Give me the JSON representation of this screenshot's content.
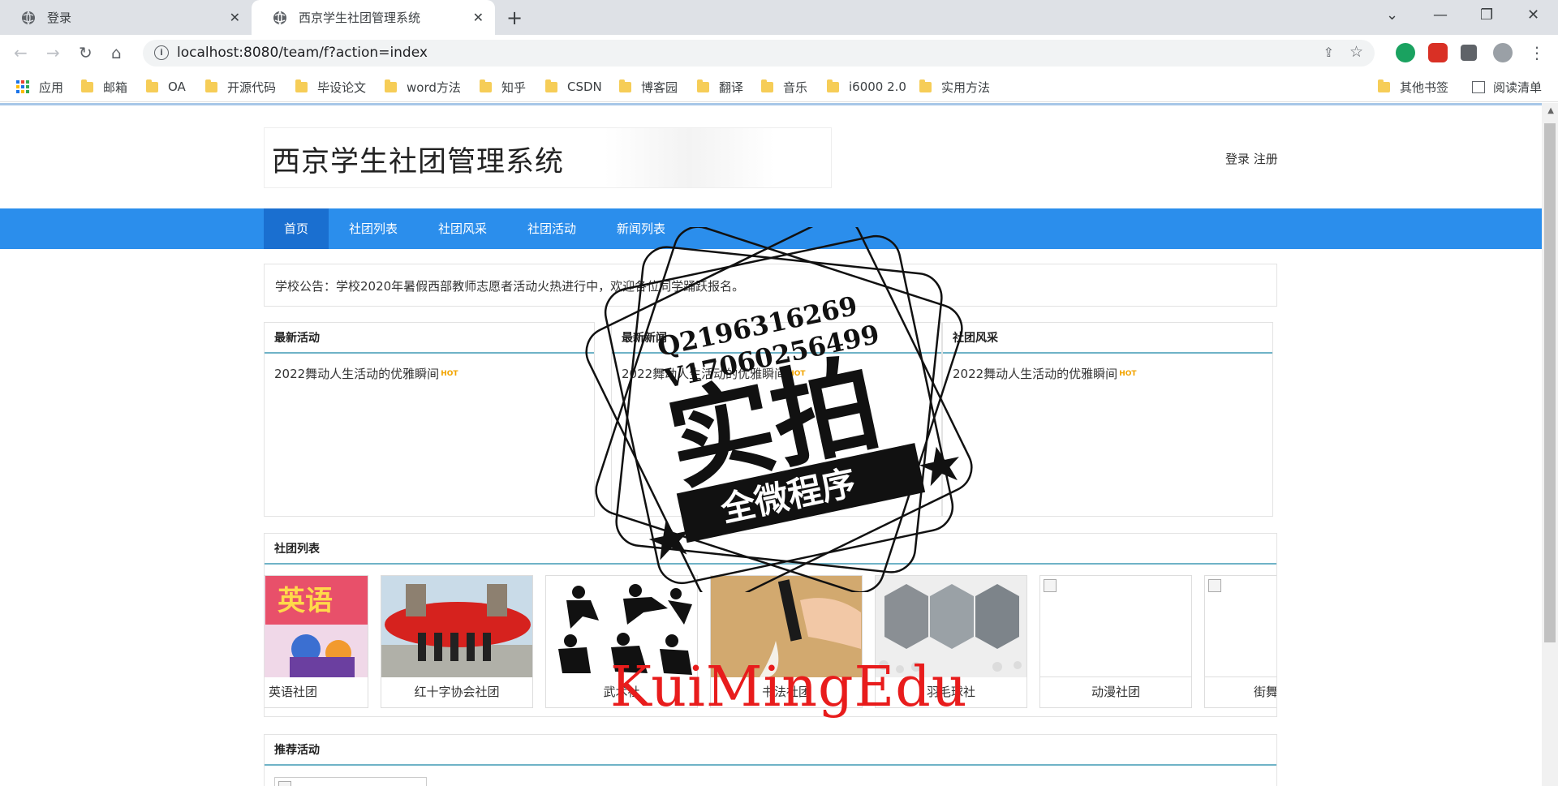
{
  "browser": {
    "tabs": [
      {
        "title": "登录"
      },
      {
        "title": "西京学生社团管理系统"
      }
    ],
    "new_tab": "+",
    "url": "localhost:8080/team/f?action=index",
    "bookmarks": [
      "应用",
      "邮箱",
      "OA",
      "开源代码",
      "毕设论文",
      "word方法",
      "知乎",
      "CSDN",
      "博客园",
      "翻译",
      "音乐",
      "i6000 2.0",
      "实用方法"
    ],
    "other_bookmarks": "其他书签",
    "reading_list": "阅读清单",
    "icons": {
      "back": "←",
      "forward": "→",
      "reload": "↻",
      "home": "⌂",
      "close": "✕",
      "star": "☆",
      "share": "⇪",
      "minimize": "—",
      "maximize": "❐",
      "chevron": "⌄"
    }
  },
  "site": {
    "title": "西京学生社团管理系统",
    "auth": "登录 注册",
    "nav": [
      "首页",
      "社团列表",
      "社团风采",
      "社团活动",
      "新闻列表"
    ],
    "notice": "学校公告：学校2020年暑假西部教师志愿者活动火热进行中，欢迎各位同学踊跃报名。",
    "panels": [
      {
        "title": "最新活动",
        "item": "2022舞动人生活动的优雅瞬间",
        "hot": "HOT"
      },
      {
        "title": "最新新闻",
        "item": "2022舞动人生活动的优雅瞬间",
        "hot": "HOT"
      },
      {
        "title": "社团风采",
        "item": "2022舞动人生活动的优雅瞬间",
        "hot": "HOT"
      }
    ],
    "club_section_title": "社团列表",
    "clubs": [
      "英语社团",
      "红十字协会社团",
      "武术社",
      "书法社团",
      "羽毛球社",
      "动漫社团",
      "街舞"
    ],
    "rec_section_title": "推荐活动"
  },
  "watermark": {
    "line1": "Q2196316269",
    "line2": "V17060256499",
    "big": "实拍",
    "banner": "全微程序",
    "red": "KuiMingEdu"
  },
  "colors": {
    "nav_blue": "#2b8eec",
    "nav_active": "#1a6fd0",
    "hot": "#f2a400",
    "red_watermark": "#e81c1c"
  }
}
